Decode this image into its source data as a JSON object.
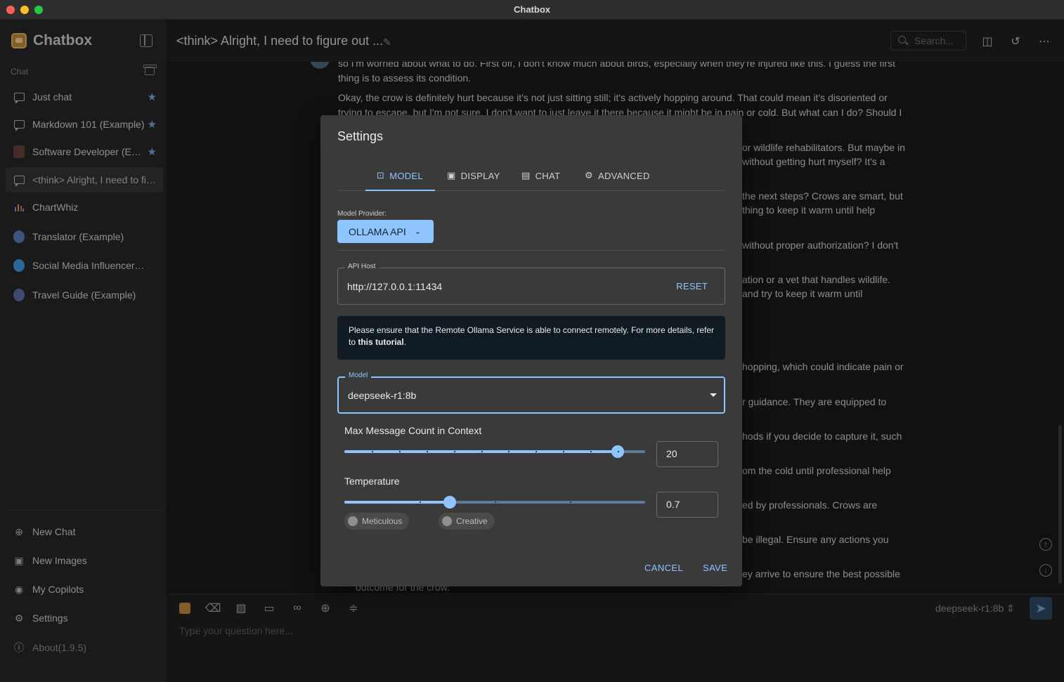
{
  "window": {
    "title": "Chatbox"
  },
  "sidebar": {
    "app_name": "Chatbox",
    "section_label": "Chat",
    "sessions": [
      {
        "label": "Just chat",
        "starred": true,
        "icon": "chat-bubble-icon"
      },
      {
        "label": "Markdown 101 (Example)",
        "starred": true,
        "icon": "chat-bubble-icon"
      },
      {
        "label": "Software Developer (Example)",
        "starred": true,
        "icon": "developer-avatar-icon"
      },
      {
        "label": "<think> Alright, I need to figure out what to do",
        "starred": false,
        "icon": "chat-bubble-icon",
        "active": true
      },
      {
        "label": "ChartWhiz",
        "starred": false,
        "icon": "chart-avatar-icon"
      },
      {
        "label": "Translator (Example)",
        "starred": false,
        "icon": "translator-avatar-icon"
      },
      {
        "label": "Social Media Influencer (Example)",
        "starred": false,
        "icon": "twitter-avatar-icon"
      },
      {
        "label": "Travel Guide (Example)",
        "starred": false,
        "icon": "globe-avatar-icon"
      }
    ],
    "bottom": {
      "new_chat": "New Chat",
      "new_images": "New Images",
      "my_copilots": "My Copilots",
      "settings": "Settings",
      "about": "About(1.9.5)"
    }
  },
  "header": {
    "title": "<think> Alright, I need to figure out ...",
    "search_placeholder": "Search..."
  },
  "messages": {
    "paragraph1": "so I'm worried about what to do. First off, I don't know much about birds, especially when they're injured like this. I guess the first thing is to assess its condition.",
    "paragraph2": "Okay, the crow is definitely hurt because it's not just sitting still; it's actively hopping around. That could mean it's disoriented or trying to escape, but I'm not sure. I don't want to just leave it there because it might be in pain or cold. But what can I do? Should I",
    "fragments": [
      "or wildlife rehabilitators. But maybe in",
      "without getting hurt myself? It's a",
      "the next steps? Crows are smart, but",
      "thing to keep it warm until help",
      "without proper authorization? I don't",
      "ation or a vet that handles wildlife.",
      "and try to keep it warm until",
      "hopping, which could indicate pain or",
      "r guidance. They are equipped to",
      "hods if you decide to capture it, such",
      "om the cold until professional help",
      "ed by professionals. Crows are",
      "be illegal. Ensure any actions you",
      "ey arrive to ensure the best possible"
    ],
    "tail": "outcome for the crow."
  },
  "composer": {
    "placeholder": "Type your question here...",
    "model": "deepseek-r1:8b"
  },
  "settings_dialog": {
    "title": "Settings",
    "tabs": [
      {
        "label": "MODEL",
        "icon": "robot-icon"
      },
      {
        "label": "DISPLAY",
        "icon": "display-icon"
      },
      {
        "label": "CHAT",
        "icon": "chat-icon"
      },
      {
        "label": "ADVANCED",
        "icon": "gear-icon"
      }
    ],
    "active_tab": "MODEL",
    "model_provider_label": "Model Provider:",
    "model_provider_value": "OLLAMA API",
    "api_host_label": "API Host",
    "api_host_value": "http://127.0.0.1:11434",
    "reset_label": "RESET",
    "alert_text": "Please ensure that the Remote Ollama Service is able to connect remotely. For more details, refer to ",
    "alert_link": "this tutorial",
    "alert_end": ".",
    "model_label": "Model",
    "model_value": "deepseek-r1:8b",
    "max_msg_label": "Max Message Count in Context",
    "max_msg_value": "20",
    "max_msg_fraction": 0.91,
    "temperature_label": "Temperature",
    "temperature_value": "0.7",
    "temperature_fraction": 0.35,
    "chip_meticulous": "Meticulous",
    "chip_creative": "Creative",
    "cancel_label": "CANCEL",
    "save_label": "SAVE"
  },
  "colors": {
    "accent": "#8ec5ff",
    "star": "#7da6e8",
    "alert_bg": "#0f1a22"
  }
}
